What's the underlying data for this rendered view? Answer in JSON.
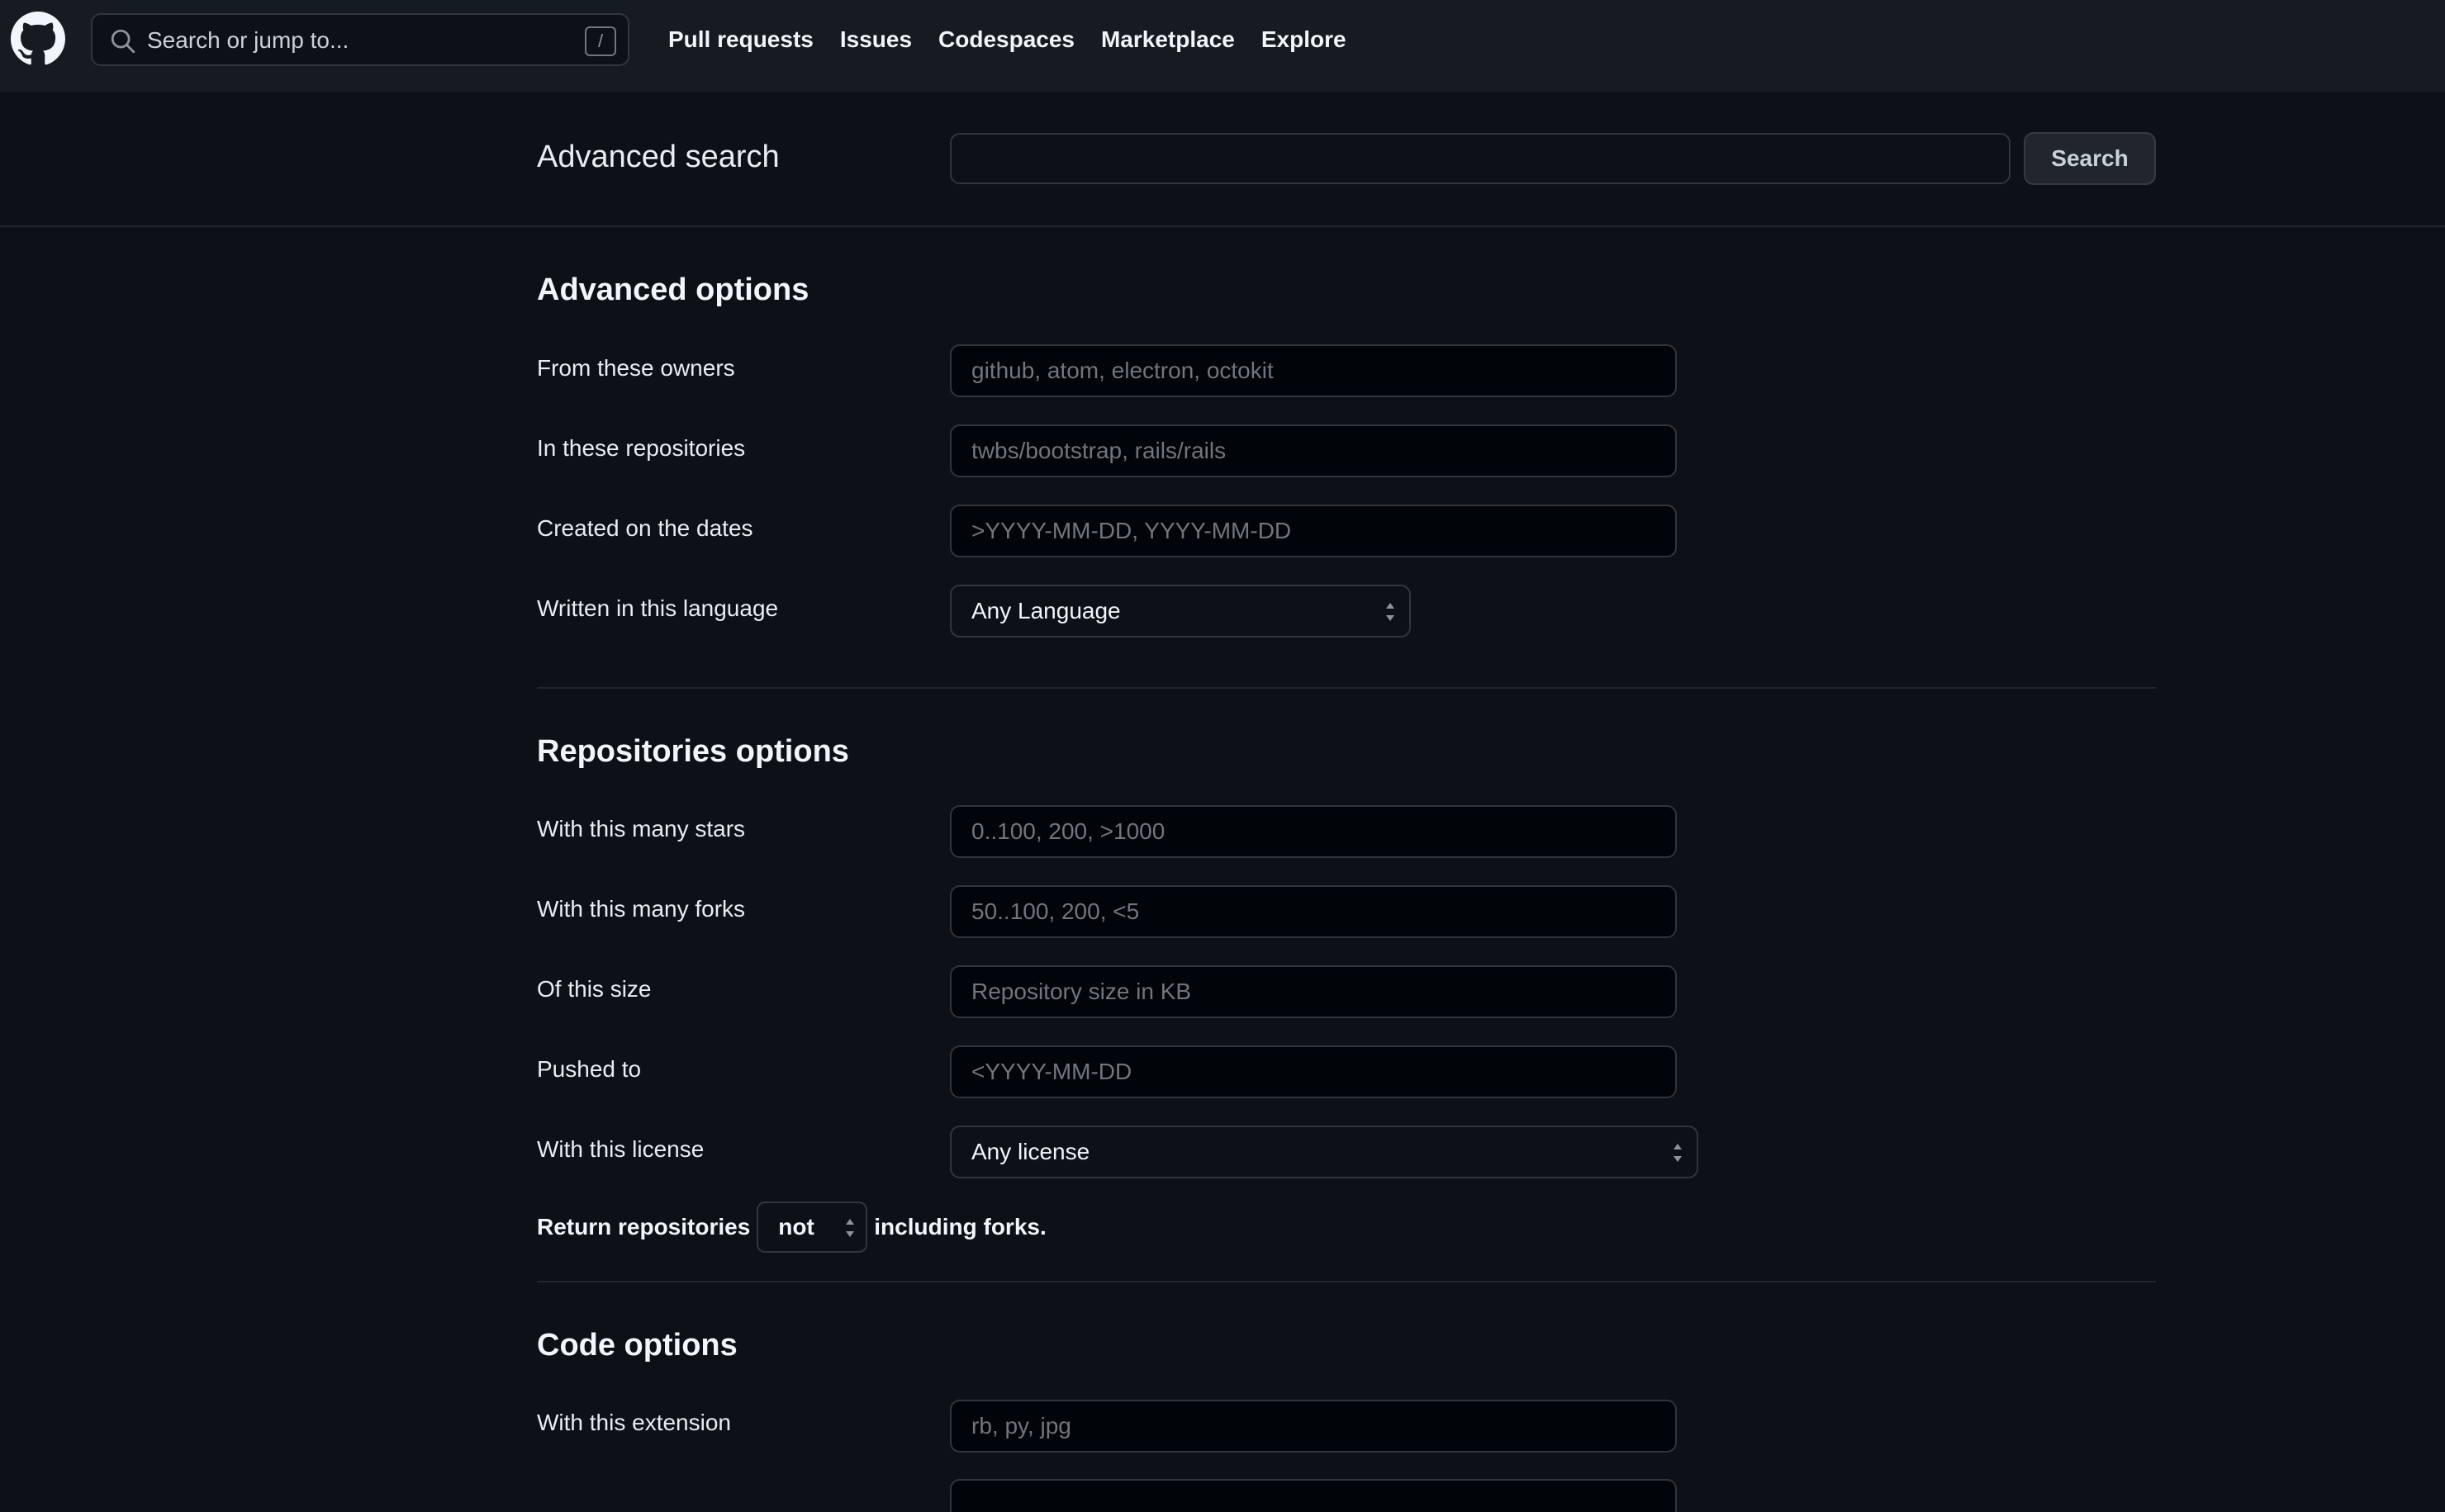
{
  "header": {
    "search_placeholder": "Search or jump to...",
    "search_shortcut": "/",
    "nav": [
      "Pull requests",
      "Issues",
      "Codespaces",
      "Marketplace",
      "Explore"
    ]
  },
  "advanced_search": {
    "title": "Advanced search",
    "query_value": "",
    "search_button": "Search"
  },
  "advanced_options": {
    "title": "Advanced options",
    "owners_label": "From these owners",
    "owners_placeholder": "github, atom, electron, octokit",
    "repos_label": "In these repositories",
    "repos_placeholder": "twbs/bootstrap, rails/rails",
    "dates_label": "Created on the dates",
    "dates_placeholder": ">YYYY-MM-DD, YYYY-MM-DD",
    "language_label": "Written in this language",
    "language_value": "Any Language"
  },
  "repositories_options": {
    "title": "Repositories options",
    "stars_label": "With this many stars",
    "stars_placeholder": "0..100, 200, >1000",
    "forks_label": "With this many forks",
    "forks_placeholder": "50..100, 200, <5",
    "size_label": "Of this size",
    "size_placeholder": "Repository size in KB",
    "pushed_label": "Pushed to",
    "pushed_placeholder": "<YYYY-MM-DD",
    "license_label": "With this license",
    "license_value": "Any license",
    "return_prefix": "Return repositories",
    "return_select": "not",
    "return_suffix": "including forks."
  },
  "code_options": {
    "title": "Code options",
    "extension_label": "With this extension",
    "extension_placeholder": "rb, py, jpg"
  },
  "colors": {
    "page_bg": "#0d1117",
    "header_bg": "#161b22",
    "border": "#30363d",
    "text": "#e6edf3",
    "placeholder": "#6e7681"
  }
}
